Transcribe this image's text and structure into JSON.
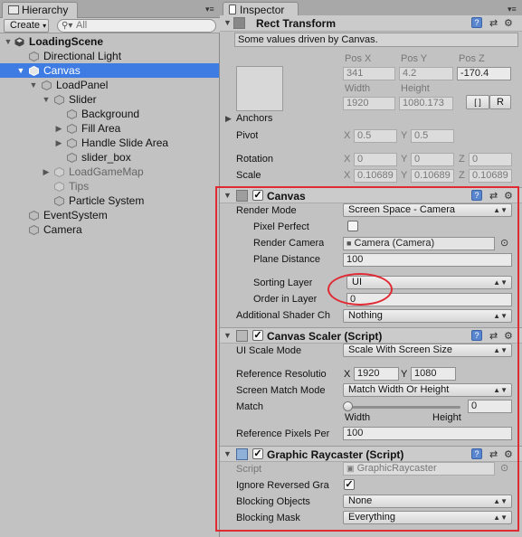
{
  "hierarchy": {
    "tab_label": "Hierarchy",
    "create_label": "Create",
    "search_placeholder": "All",
    "scene": "LoadingScene",
    "items": [
      {
        "label": "Directional Light"
      },
      {
        "label": "Canvas"
      },
      {
        "label": "LoadPanel"
      },
      {
        "label": "Slider"
      },
      {
        "label": "Background"
      },
      {
        "label": "Fill Area"
      },
      {
        "label": "Handle Slide Area"
      },
      {
        "label": "slider_box"
      },
      {
        "label": "LoadGameMap"
      },
      {
        "label": "Tips"
      },
      {
        "label": "Particle System"
      },
      {
        "label": "EventSystem"
      },
      {
        "label": "Camera"
      }
    ]
  },
  "inspector": {
    "tab_label": "Inspector",
    "rect_transform": {
      "title": "Rect Transform",
      "info": "Some values driven by Canvas.",
      "pos_x_label": "Pos X",
      "pos_y_label": "Pos Y",
      "pos_z_label": "Pos Z",
      "pos_x": "341",
      "pos_y": "4.2",
      "pos_z": "-170.4",
      "width_label": "Width",
      "height_label": "Height",
      "width": "1920",
      "height": "1080.173",
      "r_button": "R",
      "anchors_label": "Anchors",
      "pivot_label": "Pivot",
      "pivot_x": "0.5",
      "pivot_y": "0.5",
      "rotation_label": "Rotation",
      "rot_x": "0",
      "rot_y": "0",
      "rot_z": "0",
      "scale_label": "Scale",
      "scale_x": "0.10689",
      "scale_y": "0.10689",
      "scale_z": "0.10689",
      "x": "X",
      "y": "Y",
      "z": "Z"
    },
    "canvas": {
      "title": "Canvas",
      "render_mode_label": "Render Mode",
      "render_mode": "Screen Space - Camera",
      "pixel_perfect_label": "Pixel Perfect",
      "render_camera_label": "Render Camera",
      "render_camera": "Camera (Camera)",
      "plane_distance_label": "Plane Distance",
      "plane_distance": "100",
      "sorting_layer_label": "Sorting Layer",
      "sorting_layer": "UI",
      "order_in_layer_label": "Order in Layer",
      "order_in_layer": "0",
      "additional_shader_label": "Additional Shader Ch",
      "additional_shader": "Nothing"
    },
    "canvas_scaler": {
      "title": "Canvas Scaler (Script)",
      "ui_scale_mode_label": "UI Scale Mode",
      "ui_scale_mode": "Scale With Screen Size",
      "reference_resolution_label": "Reference Resolutio",
      "ref_x": "1920",
      "ref_y": "1080",
      "screen_match_mode_label": "Screen Match Mode",
      "screen_match_mode": "Match Width Or Height",
      "match_label": "Match",
      "match_value": "0",
      "match_fraction": 0,
      "width_label": "Width",
      "height_label": "Height",
      "reference_pixels_label": "Reference Pixels Per",
      "reference_pixels": "100"
    },
    "graphic_raycaster": {
      "title": "Graphic Raycaster (Script)",
      "script_label": "Script",
      "script": "GraphicRaycaster",
      "ignore_reversed_label": "Ignore Reversed Gra",
      "blocking_objects_label": "Blocking Objects",
      "blocking_objects": "None",
      "blocking_mask_label": "Blocking Mask",
      "blocking_mask": "Everything"
    }
  },
  "colors": {
    "selection": "#3e7ce4",
    "annotation": "#e02a33",
    "panel": "#c2c2c2"
  }
}
